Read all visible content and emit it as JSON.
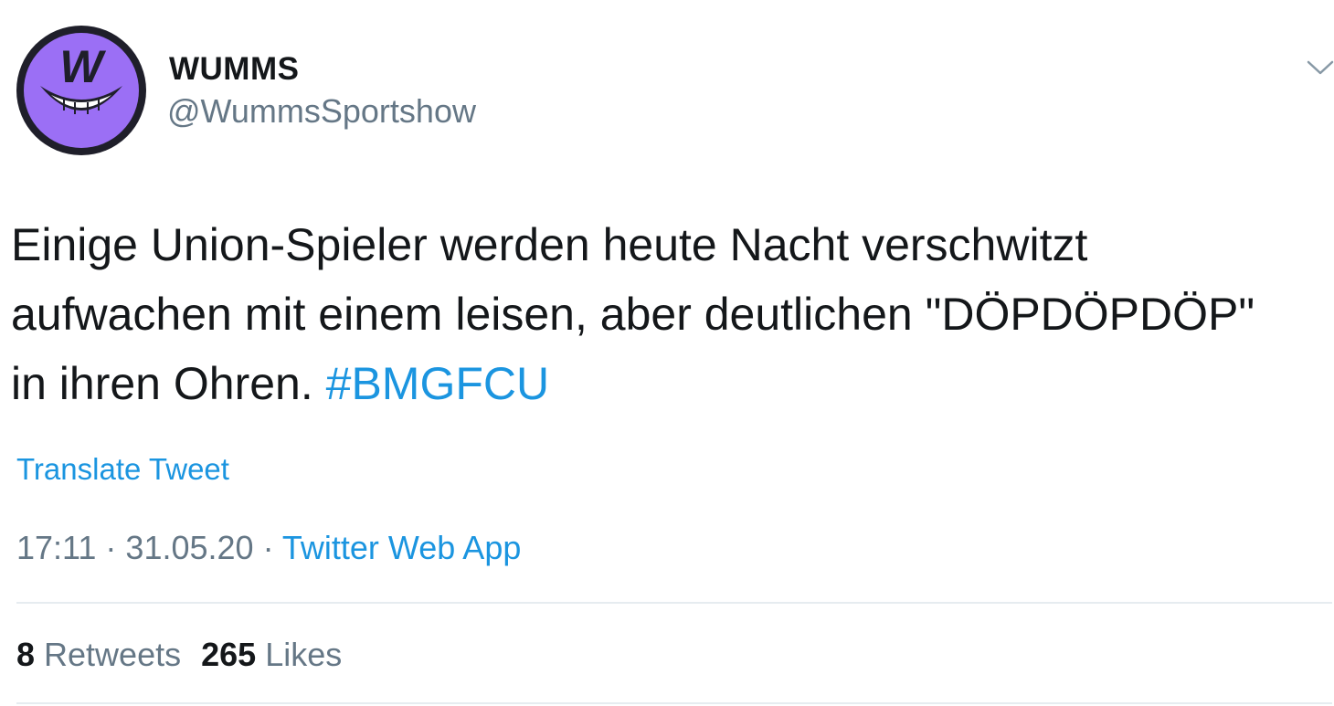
{
  "account": {
    "display_name": "WUMMS",
    "handle": "@WummsSportshow",
    "avatar_letter": "W",
    "avatar_color": "#9b6ff5",
    "avatar_bg": "#1f1f2a"
  },
  "header": {
    "menu_icon": "chevron-down-icon"
  },
  "tweet": {
    "text_line1": "Einige Union-Spieler werden heute Nacht verschwitzt",
    "text_line2": "aufwachen mit einem leisen, aber deutlichen \"DÖPDÖPDÖP\"",
    "text_line3": "in ihren Ohren. ",
    "hashtag": "#BMGFCU"
  },
  "translate_label": "Translate Tweet",
  "meta": {
    "time": "17:11",
    "separator": " · ",
    "date": "31.05.20",
    "source": "Twitter Web App"
  },
  "stats": {
    "retweets_count": "8",
    "retweets_label": " Retweets",
    "likes_count": "265",
    "likes_label": " Likes"
  },
  "colors": {
    "link": "#1b95e0",
    "secondary": "#657786",
    "primary": "#14171a",
    "divider": "#e6ecf0"
  }
}
